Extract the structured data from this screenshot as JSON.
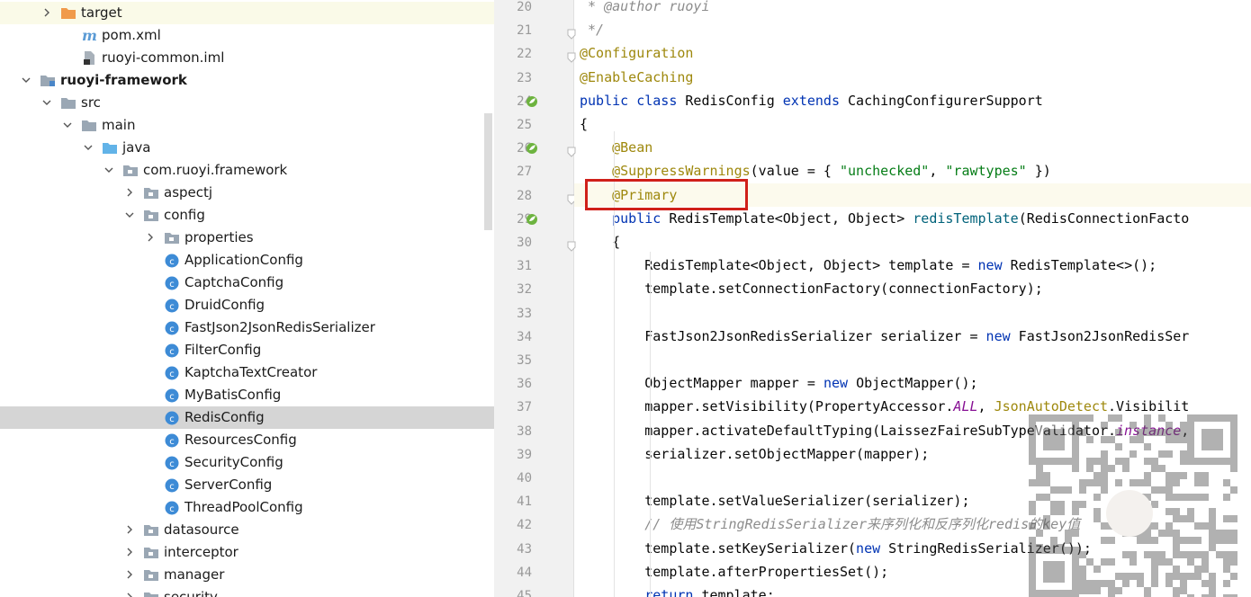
{
  "project_tree": {
    "items": [
      {
        "label": "target",
        "icon": "folder-orange-icon",
        "expanded": false
      },
      {
        "label": "pom.xml",
        "icon": "maven-icon"
      },
      {
        "label": "ruoyi-common.iml",
        "icon": "iml-file-icon"
      },
      {
        "label": "ruoyi-framework",
        "icon": "module-folder-icon",
        "expanded": true
      },
      {
        "label": "src",
        "icon": "folder-icon",
        "expanded": true
      },
      {
        "label": "main",
        "icon": "folder-icon",
        "expanded": true
      },
      {
        "label": "java",
        "icon": "source-folder-icon",
        "expanded": true
      },
      {
        "label": "com.ruoyi.framework",
        "icon": "package-icon",
        "expanded": true
      },
      {
        "label": "aspectj",
        "icon": "package-icon",
        "expanded": false
      },
      {
        "label": "config",
        "icon": "package-icon",
        "expanded": true
      },
      {
        "label": "properties",
        "icon": "package-icon",
        "expanded": false
      },
      {
        "label": "ApplicationConfig",
        "icon": "class-icon"
      },
      {
        "label": "CaptchaConfig",
        "icon": "class-icon"
      },
      {
        "label": "DruidConfig",
        "icon": "class-icon"
      },
      {
        "label": "FastJson2JsonRedisSerializer",
        "icon": "class-icon"
      },
      {
        "label": "FilterConfig",
        "icon": "class-icon"
      },
      {
        "label": "KaptchaTextCreator",
        "icon": "class-icon"
      },
      {
        "label": "MyBatisConfig",
        "icon": "class-icon"
      },
      {
        "label": "RedisConfig",
        "icon": "class-icon",
        "selected": true
      },
      {
        "label": "ResourcesConfig",
        "icon": "class-icon"
      },
      {
        "label": "SecurityConfig",
        "icon": "class-icon"
      },
      {
        "label": "ServerConfig",
        "icon": "class-icon"
      },
      {
        "label": "ThreadPoolConfig",
        "icon": "class-icon"
      },
      {
        "label": "datasource",
        "icon": "package-icon",
        "expanded": false
      },
      {
        "label": "interceptor",
        "icon": "package-icon",
        "expanded": false
      },
      {
        "label": "manager",
        "icon": "package-icon",
        "expanded": false
      },
      {
        "label": "security",
        "icon": "package-icon",
        "expanded": false
      }
    ]
  },
  "editor": {
    "current_line": 28,
    "lines": [
      {
        "n": "20",
        "tokens": [
          {
            "t": " * ",
            "c": "cm"
          },
          {
            "t": "@author",
            "c": "cm"
          },
          {
            "t": " ruoyi",
            "c": "cm"
          }
        ]
      },
      {
        "n": "21",
        "tokens": [
          {
            "t": " */",
            "c": "cm"
          }
        ]
      },
      {
        "n": "22",
        "tokens": [
          {
            "t": "@Configuration",
            "c": "an"
          }
        ]
      },
      {
        "n": "23",
        "tokens": [
          {
            "t": "@EnableCaching",
            "c": "an"
          }
        ]
      },
      {
        "n": "24",
        "tokens": [
          {
            "t": "public class ",
            "c": "kw"
          },
          {
            "t": "RedisConfig ",
            "c": ""
          },
          {
            "t": "extends ",
            "c": "kw"
          },
          {
            "t": "CachingConfigurerSupport",
            "c": ""
          }
        ]
      },
      {
        "n": "25",
        "tokens": [
          {
            "t": "{",
            "c": ""
          }
        ]
      },
      {
        "n": "26",
        "tokens": [
          {
            "t": "    ",
            "c": ""
          },
          {
            "t": "@Bean",
            "c": "an"
          }
        ]
      },
      {
        "n": "27",
        "tokens": [
          {
            "t": "    ",
            "c": ""
          },
          {
            "t": "@SuppressWarnings",
            "c": "an"
          },
          {
            "t": "(value = { ",
            "c": ""
          },
          {
            "t": "\"unchecked\"",
            "c": "str"
          },
          {
            "t": ", ",
            "c": ""
          },
          {
            "t": "\"rawtypes\"",
            "c": "str"
          },
          {
            "t": " })",
            "c": ""
          }
        ]
      },
      {
        "n": "28",
        "tokens": [
          {
            "t": "    ",
            "c": ""
          },
          {
            "t": "@Primary",
            "c": "an"
          }
        ]
      },
      {
        "n": "29",
        "tokens": [
          {
            "t": "    ",
            "c": ""
          },
          {
            "t": "public ",
            "c": "kw"
          },
          {
            "t": "RedisTemplate<Object, Object> ",
            "c": ""
          },
          {
            "t": "redisTemplate",
            "c": "fn"
          },
          {
            "t": "(RedisConnectionFacto",
            "c": ""
          }
        ]
      },
      {
        "n": "30",
        "tokens": [
          {
            "t": "    {",
            "c": ""
          }
        ]
      },
      {
        "n": "31",
        "tokens": [
          {
            "t": "        RedisTemplate<Object, Object> template = ",
            "c": ""
          },
          {
            "t": "new ",
            "c": "kw"
          },
          {
            "t": "RedisTemplate<>();",
            "c": ""
          }
        ]
      },
      {
        "n": "32",
        "tokens": [
          {
            "t": "        template.setConnectionFactory(connectionFactory);",
            "c": ""
          }
        ]
      },
      {
        "n": "33",
        "tokens": []
      },
      {
        "n": "34",
        "tokens": [
          {
            "t": "        FastJson2JsonRedisSerializer serializer = ",
            "c": ""
          },
          {
            "t": "new ",
            "c": "kw"
          },
          {
            "t": "FastJson2JsonRedisSer",
            "c": ""
          }
        ]
      },
      {
        "n": "35",
        "tokens": []
      },
      {
        "n": "36",
        "tokens": [
          {
            "t": "        ObjectMapper mapper = ",
            "c": ""
          },
          {
            "t": "new ",
            "c": "kw"
          },
          {
            "t": "ObjectMapper();",
            "c": ""
          }
        ]
      },
      {
        "n": "37",
        "tokens": [
          {
            "t": "        mapper.setVisibility(PropertyAccessor.",
            "c": ""
          },
          {
            "t": "ALL",
            "c": "sf"
          },
          {
            "t": ", ",
            "c": ""
          },
          {
            "t": "JsonAutoDetect",
            "c": "an"
          },
          {
            "t": ".Visibilit",
            "c": ""
          }
        ]
      },
      {
        "n": "38",
        "tokens": [
          {
            "t": "        mapper.activateDefaultTyping(LaissezFaireSubTypeValidator.",
            "c": ""
          },
          {
            "t": "instance",
            "c": "sf"
          },
          {
            "t": ",",
            "c": ""
          }
        ]
      },
      {
        "n": "39",
        "tokens": [
          {
            "t": "        serializer.setObjectMapper(mapper);",
            "c": ""
          }
        ]
      },
      {
        "n": "40",
        "tokens": []
      },
      {
        "n": "41",
        "tokens": [
          {
            "t": "        template.setValueSerializer(serializer);",
            "c": ""
          }
        ]
      },
      {
        "n": "42",
        "tokens": [
          {
            "t": "        // 使用StringRedisSerializer来序列化和反序列化redis的key值",
            "c": "cm"
          }
        ]
      },
      {
        "n": "43",
        "tokens": [
          {
            "t": "        template.setKeySerializer(",
            "c": ""
          },
          {
            "t": "new ",
            "c": "kw"
          },
          {
            "t": "StringRedisSerializer());",
            "c": ""
          }
        ]
      },
      {
        "n": "44",
        "tokens": [
          {
            "t": "        template.afterPropertiesSet();",
            "c": ""
          }
        ]
      },
      {
        "n": "45",
        "tokens": [
          {
            "t": "        ",
            "c": ""
          },
          {
            "t": "return ",
            "c": "kw"
          },
          {
            "t": "template;",
            "c": ""
          }
        ]
      }
    ]
  },
  "colors": {
    "keyword": "#0033b3",
    "annotation": "#9e880d",
    "string": "#067d17",
    "comment": "#8c8c8c",
    "method": "#00627a",
    "static_field": "#871094",
    "highlight_box": "#d0201a",
    "selection": "#d5d5d5"
  }
}
